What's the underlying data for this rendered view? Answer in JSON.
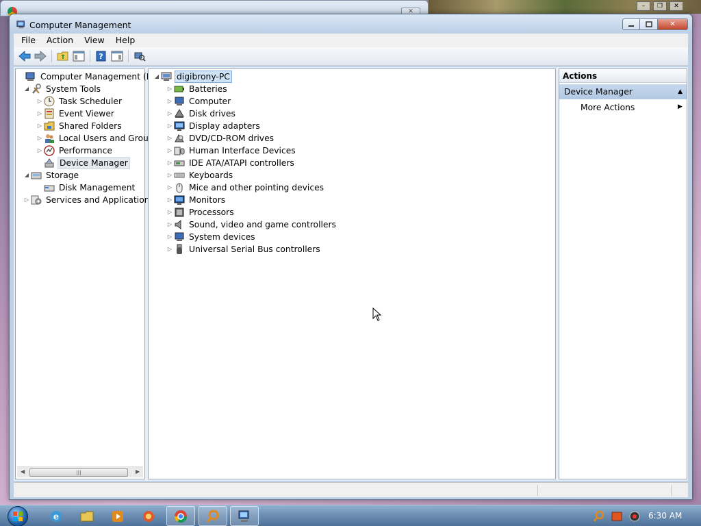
{
  "window": {
    "title": "Computer Management"
  },
  "menu": {
    "file": "File",
    "action": "Action",
    "view": "View",
    "help": "Help"
  },
  "left_tree": {
    "root": "Computer Management (Local",
    "system_tools": "System Tools",
    "task_scheduler": "Task Scheduler",
    "event_viewer": "Event Viewer",
    "shared_folders": "Shared Folders",
    "local_users": "Local Users and Groups",
    "performance": "Performance",
    "device_manager": "Device Manager",
    "storage": "Storage",
    "disk_management": "Disk Management",
    "services": "Services and Applications"
  },
  "device_tree": {
    "computer_name": "digibrony-PC",
    "categories": [
      "Batteries",
      "Computer",
      "Disk drives",
      "Display adapters",
      "DVD/CD-ROM drives",
      "Human Interface Devices",
      "IDE ATA/ATAPI controllers",
      "Keyboards",
      "Mice and other pointing devices",
      "Monitors",
      "Processors",
      "Sound, video and game controllers",
      "System devices",
      "Universal Serial Bus controllers"
    ]
  },
  "actions": {
    "header": "Actions",
    "section": "Device Manager",
    "more_actions": "More Actions"
  },
  "taskbar": {
    "clock": "6:30 AM"
  },
  "colors": {
    "accent": "#bfd1e6",
    "selection": "#cfe3f7",
    "actions_section": "#b2c9e4"
  }
}
